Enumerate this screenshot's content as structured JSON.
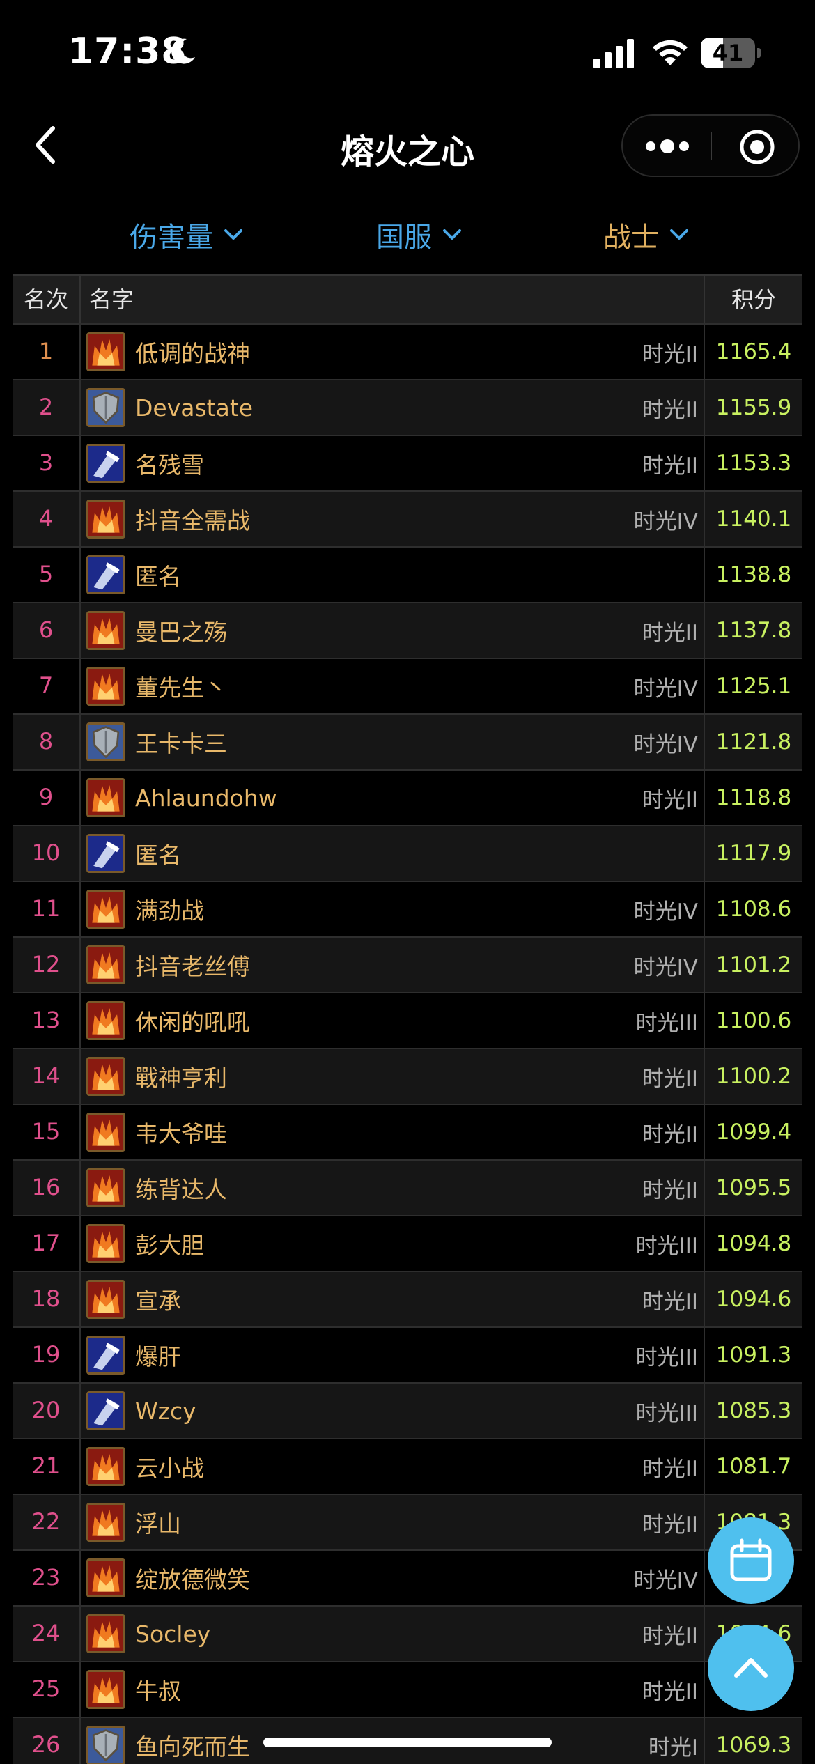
{
  "status_bar": {
    "time": "17:38",
    "battery": "41",
    "battery_level": 0.41
  },
  "nav": {
    "title": "熔火之心"
  },
  "filters": {
    "damage": "伤害量",
    "server": "国服",
    "class": "战士"
  },
  "table": {
    "headers": {
      "rank": "名次",
      "name": "名字",
      "score": "积分"
    },
    "rows": [
      {
        "rank": "1",
        "name": "低调的战神",
        "tag": "时光II",
        "score": "1165.4",
        "spec": "fury"
      },
      {
        "rank": "2",
        "name": "Devastate",
        "tag": "时光II",
        "score": "1155.9",
        "spec": "prot"
      },
      {
        "rank": "3",
        "name": "名残雪",
        "tag": "时光II",
        "score": "1153.3",
        "spec": "arms"
      },
      {
        "rank": "4",
        "name": "抖音全需战",
        "tag": "时光IV",
        "score": "1140.1",
        "spec": "fury"
      },
      {
        "rank": "5",
        "name": "匿名",
        "tag": "",
        "score": "1138.8",
        "spec": "arms"
      },
      {
        "rank": "6",
        "name": "曼巴之殇",
        "tag": "时光II",
        "score": "1137.8",
        "spec": "fury"
      },
      {
        "rank": "7",
        "name": "董先生丶",
        "tag": "时光IV",
        "score": "1125.1",
        "spec": "fury"
      },
      {
        "rank": "8",
        "name": "王卡卡三",
        "tag": "时光IV",
        "score": "1121.8",
        "spec": "prot"
      },
      {
        "rank": "9",
        "name": "Ahlaundohw",
        "tag": "时光II",
        "score": "1118.8",
        "spec": "fury"
      },
      {
        "rank": "10",
        "name": "匿名",
        "tag": "",
        "score": "1117.9",
        "spec": "arms"
      },
      {
        "rank": "11",
        "name": "满劲战",
        "tag": "时光IV",
        "score": "1108.6",
        "spec": "fury"
      },
      {
        "rank": "12",
        "name": "抖音老丝傅",
        "tag": "时光IV",
        "score": "1101.2",
        "spec": "fury"
      },
      {
        "rank": "13",
        "name": "休闲的吼吼",
        "tag": "时光III",
        "score": "1100.6",
        "spec": "fury"
      },
      {
        "rank": "14",
        "name": "戰神亨利",
        "tag": "时光II",
        "score": "1100.2",
        "spec": "fury"
      },
      {
        "rank": "15",
        "name": "韦大爷哇",
        "tag": "时光II",
        "score": "1099.4",
        "spec": "fury"
      },
      {
        "rank": "16",
        "name": "练背达人",
        "tag": "时光II",
        "score": "1095.5",
        "spec": "fury"
      },
      {
        "rank": "17",
        "name": "彭大胆",
        "tag": "时光III",
        "score": "1094.8",
        "spec": "fury"
      },
      {
        "rank": "18",
        "name": "宣承",
        "tag": "时光II",
        "score": "1094.6",
        "spec": "fury"
      },
      {
        "rank": "19",
        "name": "爆肝",
        "tag": "时光III",
        "score": "1091.3",
        "spec": "arms"
      },
      {
        "rank": "20",
        "name": "Wzcy",
        "tag": "时光III",
        "score": "1085.3",
        "spec": "arms"
      },
      {
        "rank": "21",
        "name": "云小战",
        "tag": "时光II",
        "score": "1081.7",
        "spec": "fury"
      },
      {
        "rank": "22",
        "name": "浮山",
        "tag": "时光II",
        "score": "1081.3",
        "spec": "fury"
      },
      {
        "rank": "23",
        "name": "绽放德微笑",
        "tag": "时光IV",
        "score": "",
        "spec": "fury"
      },
      {
        "rank": "24",
        "name": "Socley",
        "tag": "时光II",
        "score": "1074.6",
        "spec": "fury"
      },
      {
        "rank": "25",
        "name": "牛叔",
        "tag": "时光II",
        "score": "",
        "spec": "fury"
      },
      {
        "rank": "26",
        "name": "鱼向死而生",
        "tag": "时光I",
        "score": "1069.3",
        "spec": "prot"
      }
    ]
  },
  "icons": {
    "back": "chevron-left-icon",
    "more": "more-dots-icon",
    "target": "target-icon",
    "calendar": "calendar-icon",
    "scroll_top": "chevron-up-icon",
    "spec_fury": "fury-spec-icon",
    "spec_arms": "arms-spec-icon",
    "spec_prot": "prot-spec-icon"
  },
  "colors": {
    "accent_blue": "#4aa8e8",
    "class_gold": "#e0b060",
    "name_gold": "#e8b86a",
    "rank_pink": "#e0508c",
    "score_green": "#c8f060",
    "fab_blue": "#4fc0ee"
  }
}
